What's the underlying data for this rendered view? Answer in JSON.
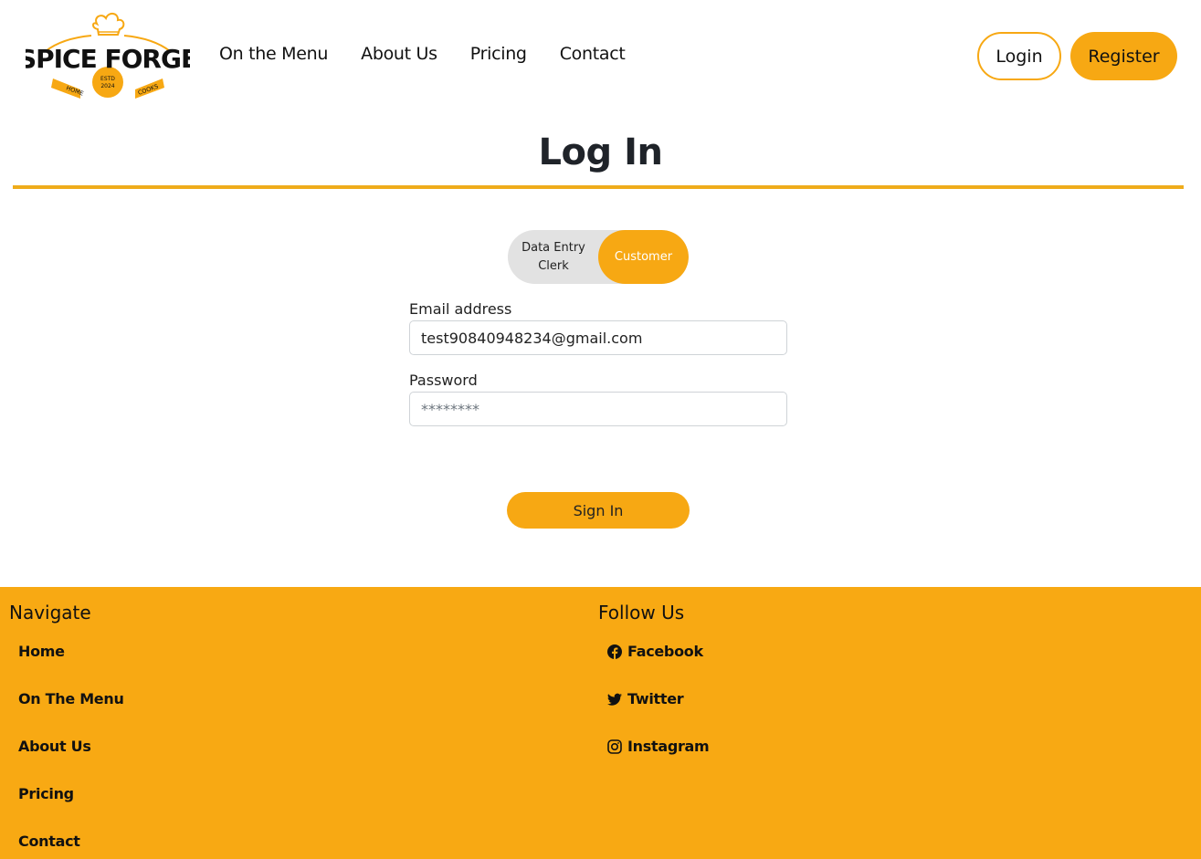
{
  "header": {
    "logo": {
      "brand_text": "SPICE FORGE",
      "ribbon_left": "HOME",
      "ribbon_right": "COOKS",
      "badge_top": "ESTD",
      "badge_bottom": "2024"
    },
    "nav": [
      {
        "label": "On the Menu"
      },
      {
        "label": "About Us"
      },
      {
        "label": "Pricing"
      },
      {
        "label": "Contact"
      }
    ],
    "login_label": "Login",
    "register_label": "Register"
  },
  "main": {
    "title": "Log In",
    "toggle": {
      "clerk_label_line1": "Data Entry",
      "clerk_label_line2": "Clerk",
      "customer_label": "Customer",
      "selected": "Customer"
    },
    "email": {
      "label": "Email address",
      "value": "test90840948234@gmail.com"
    },
    "password": {
      "label": "Password",
      "placeholder": "********"
    },
    "signin_label": "Sign In"
  },
  "footer": {
    "navigate_heading": "Navigate",
    "navigate_links": [
      {
        "label": "Home"
      },
      {
        "label": "On The Menu"
      },
      {
        "label": "About Us"
      },
      {
        "label": "Pricing"
      },
      {
        "label": "Contact"
      }
    ],
    "follow_heading": "Follow Us",
    "social_links": [
      {
        "label": "Facebook",
        "icon": "facebook-icon"
      },
      {
        "label": "Twitter",
        "icon": "twitter-icon"
      },
      {
        "label": "Instagram",
        "icon": "instagram-icon"
      }
    ]
  },
  "colors": {
    "accent": "#f7a813",
    "footer_bg": "#f8a913",
    "rule": "#efac1b",
    "toggle_bg": "#e2e2e2"
  }
}
